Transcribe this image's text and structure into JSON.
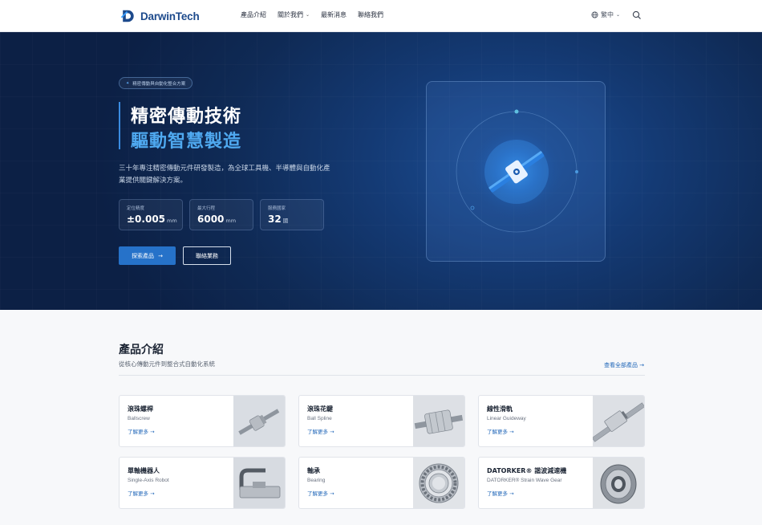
{
  "header": {
    "brand": "DarwinTech",
    "nav": [
      {
        "label": "產品介紹",
        "has_caret": false
      },
      {
        "label": "關於我們",
        "has_caret": true
      },
      {
        "label": "最新消息",
        "has_caret": false
      },
      {
        "label": "聯絡我們",
        "has_caret": false
      }
    ],
    "language": "繁中",
    "icons": {
      "globe": "globe-icon",
      "search": "search-icon",
      "caret": "chevron-down-icon"
    }
  },
  "hero": {
    "badge": "精密傳動與自動化整合方案",
    "title_line1": "精密傳動技術",
    "title_line2": "驅動智慧製造",
    "description": "三十年專注精密傳動元件研發製造，為全球工具機、半導體與自動化產業提供關鍵解決方案。",
    "stats": [
      {
        "label": "定位精度",
        "value": "±0.005",
        "unit": "mm"
      },
      {
        "label": "最大行程",
        "value": "6000",
        "unit": "mm"
      },
      {
        "label": "服務國家",
        "value": "32",
        "unit": "國"
      }
    ],
    "primary_button": "探索產品",
    "secondary_button": "聯絡業務",
    "accent_color": "#4fa9f0"
  },
  "products": {
    "title": "產品介紹",
    "subtitle": "從核心傳動元件到整合式自動化系統",
    "view_all": "查看全部產品",
    "items": [
      {
        "name": "滾珠螺桿",
        "en": "Ballscrew",
        "more": "了解更多"
      },
      {
        "name": "滾珠花鍵",
        "en": "Ball Spline",
        "more": "了解更多"
      },
      {
        "name": "線性滑軌",
        "en": "Linear Guideway",
        "more": "了解更多"
      },
      {
        "name": "單軸機器人",
        "en": "Single-Axis Robot",
        "more": "了解更多"
      },
      {
        "name": "軸承",
        "en": "Bearing",
        "more": "了解更多"
      },
      {
        "name": "DATORKER® 諧波減速機",
        "en": "DATORKER® Strain Wave Gear",
        "more": "了解更多"
      }
    ]
  },
  "colors": {
    "brand": "#1d4a8c",
    "primary": "#2672c9",
    "link": "#1f66b8"
  }
}
